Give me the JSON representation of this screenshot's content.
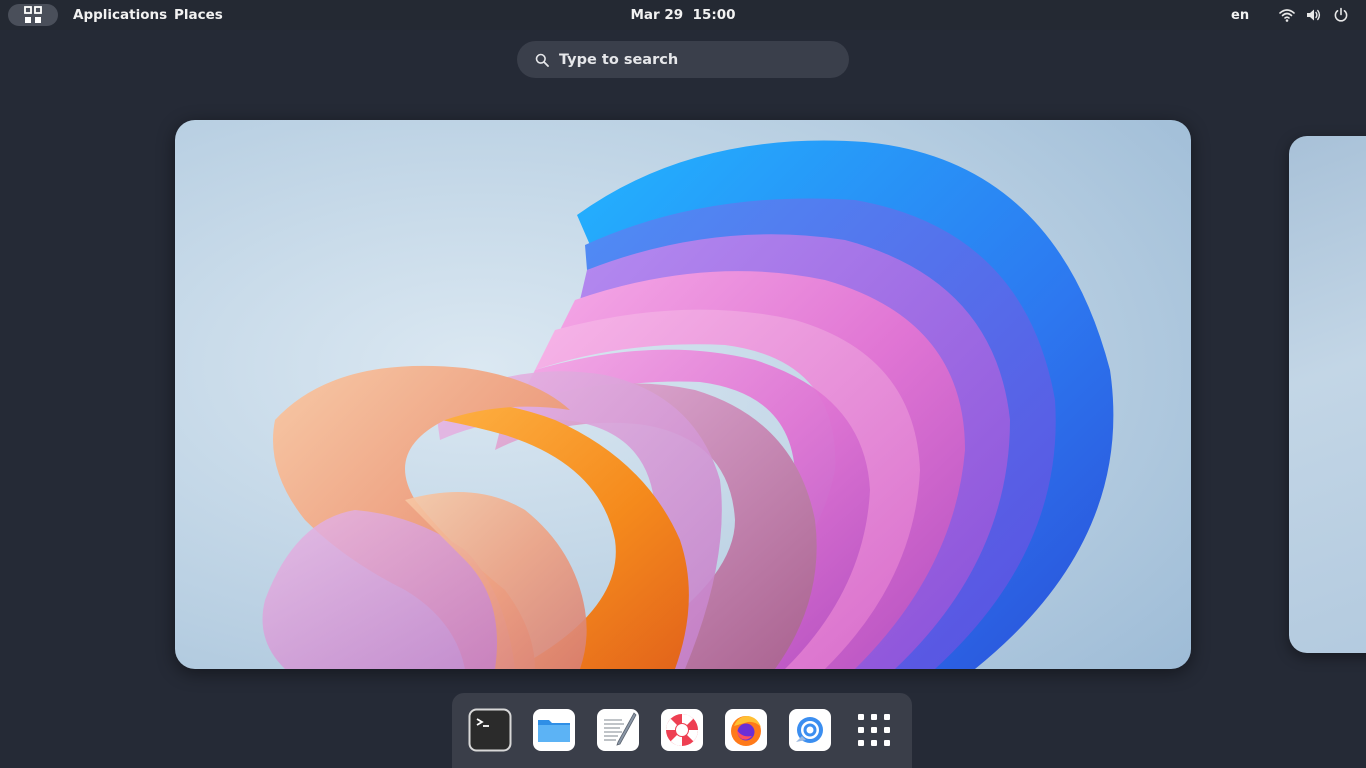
{
  "topbar": {
    "activities_icon": "activities-grid-icon",
    "applications_label": "Applications",
    "places_label": "Places",
    "clock": "Mar 29  15:00",
    "language": "en",
    "status_icons": [
      "wifi-icon",
      "volume-icon",
      "power-icon"
    ]
  },
  "search": {
    "placeholder": "Type to search",
    "icon": "search-icon"
  },
  "workspaces": {
    "current": "workspace-1",
    "wallpaper": "colorful-bloom-wallpaper"
  },
  "dash": {
    "items": [
      {
        "name": "terminal",
        "icon": "terminal-icon"
      },
      {
        "name": "files",
        "icon": "files-folder-icon"
      },
      {
        "name": "text-editor",
        "icon": "text-editor-icon"
      },
      {
        "name": "help",
        "icon": "help-lifebuoy-icon"
      },
      {
        "name": "firefox",
        "icon": "firefox-icon"
      },
      {
        "name": "web-browser",
        "icon": "web-browser-icon"
      },
      {
        "name": "show-applications",
        "icon": "app-grid-icon"
      }
    ]
  },
  "colors": {
    "background": "#252a36",
    "topbar": "#242933",
    "search_bg": "#3a3f4b",
    "dash_bg": "#3a3e49"
  }
}
